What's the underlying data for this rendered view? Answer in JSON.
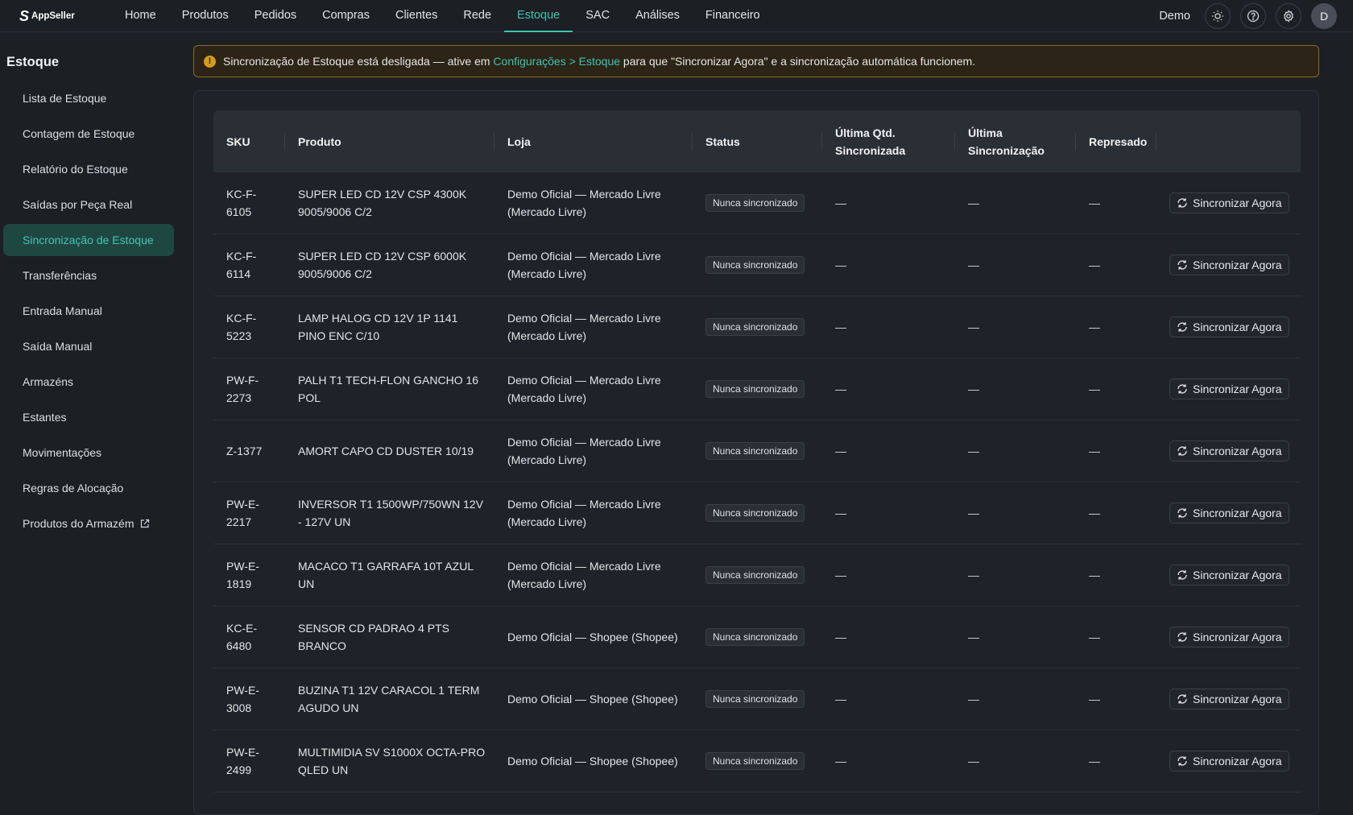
{
  "app": {
    "logo_text": "AppSeller",
    "logo_mark": "S"
  },
  "nav": {
    "items": [
      {
        "label": "Home"
      },
      {
        "label": "Produtos"
      },
      {
        "label": "Pedidos"
      },
      {
        "label": "Compras"
      },
      {
        "label": "Clientes"
      },
      {
        "label": "Rede"
      },
      {
        "label": "Estoque"
      },
      {
        "label": "SAC"
      },
      {
        "label": "Análises"
      },
      {
        "label": "Financeiro"
      }
    ],
    "active": "Estoque",
    "user_name": "Demo",
    "avatar_initial": "D"
  },
  "sidebar": {
    "title": "Estoque",
    "items": [
      {
        "label": "Lista de Estoque"
      },
      {
        "label": "Contagem de Estoque"
      },
      {
        "label": "Relatório do Estoque"
      },
      {
        "label": "Saídas por Peça Real"
      },
      {
        "label": "Sincronização de Estoque"
      },
      {
        "label": "Transferências"
      },
      {
        "label": "Entrada Manual"
      },
      {
        "label": "Saída Manual"
      },
      {
        "label": "Armazéns"
      },
      {
        "label": "Estantes"
      },
      {
        "label": "Movimentações"
      },
      {
        "label": "Regras de Alocação"
      },
      {
        "label": "Produtos do Armazém"
      }
    ],
    "active_index": 4
  },
  "alert": {
    "text_before": "Sincronização de Estoque está desligada — ative em ",
    "link_text": "Configurações > Estoque",
    "text_after": " para que \"Sincronizar Agora\" e a sincronização automática funcionem."
  },
  "table": {
    "headers": [
      "SKU",
      "Produto",
      "Loja",
      "Status",
      "Última Qtd. Sincronizada",
      "Última Sincronização",
      "Represado",
      ""
    ],
    "action_label": "Sincronizar Agora",
    "rows": [
      {
        "sku": "KC-F-6105",
        "product": "SUPER LED CD 12V CSP 4300K 9005/9006 C/2",
        "store": "Demo Oficial — Mercado Livre (Mercado Livre)",
        "status": "Nunca sincronizado",
        "last_qty": "—",
        "last_sync": "—",
        "held": "—"
      },
      {
        "sku": "KC-F-6114",
        "product": "SUPER LED CD 12V CSP 6000K 9005/9006 C/2",
        "store": "Demo Oficial — Mercado Livre (Mercado Livre)",
        "status": "Nunca sincronizado",
        "last_qty": "—",
        "last_sync": "—",
        "held": "—"
      },
      {
        "sku": "KC-F-5223",
        "product": "LAMP HALOG CD 12V 1P 1141 PINO ENC C/10",
        "store": "Demo Oficial — Mercado Livre (Mercado Livre)",
        "status": "Nunca sincronizado",
        "last_qty": "—",
        "last_sync": "—",
        "held": "—"
      },
      {
        "sku": "PW-F-2273",
        "product": "PALH T1 TECH-FLON GANCHO 16 POL",
        "store": "Demo Oficial — Mercado Livre (Mercado Livre)",
        "status": "Nunca sincronizado",
        "last_qty": "—",
        "last_sync": "—",
        "held": "—"
      },
      {
        "sku": "Z-1377",
        "product": "AMORT CAPO CD DUSTER 10/19",
        "store": "Demo Oficial — Mercado Livre (Mercado Livre)",
        "status": "Nunca sincronizado",
        "last_qty": "—",
        "last_sync": "—",
        "held": "—"
      },
      {
        "sku": "PW-E-2217",
        "product": "INVERSOR T1 1500WP/750WN 12V - 127V UN",
        "store": "Demo Oficial — Mercado Livre (Mercado Livre)",
        "status": "Nunca sincronizado",
        "last_qty": "—",
        "last_sync": "—",
        "held": "—"
      },
      {
        "sku": "PW-E-1819",
        "product": "MACACO T1 GARRAFA 10T AZUL UN",
        "store": "Demo Oficial — Mercado Livre (Mercado Livre)",
        "status": "Nunca sincronizado",
        "last_qty": "—",
        "last_sync": "—",
        "held": "—"
      },
      {
        "sku": "KC-E-6480",
        "product": "SENSOR CD PADRAO 4 PTS BRANCO",
        "store": "Demo Oficial — Shopee (Shopee)",
        "status": "Nunca sincronizado",
        "last_qty": "—",
        "last_sync": "—",
        "held": "—"
      },
      {
        "sku": "PW-E-3008",
        "product": "BUZINA T1 12V CARACOL 1 TERM AGUDO UN",
        "store": "Demo Oficial — Shopee (Shopee)",
        "status": "Nunca sincronizado",
        "last_qty": "—",
        "last_sync": "—",
        "held": "—"
      },
      {
        "sku": "PW-E-2499",
        "product": "MULTIMIDIA SV S1000X OCTA-PRO QLED UN",
        "store": "Demo Oficial — Shopee (Shopee)",
        "status": "Nunca sincronizado",
        "last_qty": "—",
        "last_sync": "—",
        "held": "—"
      }
    ]
  },
  "colors": {
    "accent": "#3fc2b0",
    "background": "#1c1f24",
    "warning": "#d49a1a"
  },
  "icons": [
    "sun-icon",
    "help-icon",
    "gear-icon",
    "warning-icon",
    "external-link-icon",
    "refresh-icon"
  ]
}
